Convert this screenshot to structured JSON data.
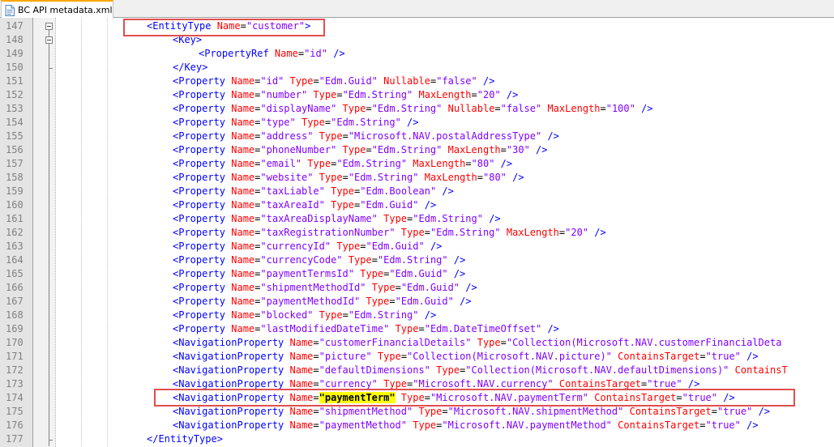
{
  "tab": {
    "label": "BC API metadata.xml",
    "icon": "xml-file-icon"
  },
  "lines": [
    {
      "num": "147",
      "indent": 12,
      "segs": [
        [
          "tag",
          "<EntityType "
        ],
        [
          "attr",
          "Name"
        ],
        [
          "eq",
          "="
        ],
        [
          "val",
          "\"customer\""
        ],
        [
          "tag",
          ">"
        ]
      ]
    },
    {
      "num": "148",
      "indent": 16,
      "segs": [
        [
          "tag",
          "<Key>"
        ]
      ]
    },
    {
      "num": "149",
      "indent": 20,
      "segs": [
        [
          "tag",
          "<PropertyRef "
        ],
        [
          "attr",
          "Name"
        ],
        [
          "eq",
          "="
        ],
        [
          "val",
          "\"id\""
        ],
        [
          "tag",
          " />"
        ]
      ]
    },
    {
      "num": "150",
      "indent": 16,
      "segs": [
        [
          "tag",
          "</Key>"
        ]
      ]
    },
    {
      "num": "151",
      "indent": 16,
      "segs": [
        [
          "tag",
          "<Property "
        ],
        [
          "attr",
          "Name"
        ],
        [
          "eq",
          "="
        ],
        [
          "val",
          "\"id\""
        ],
        [
          "tag",
          " "
        ],
        [
          "attr",
          "Type"
        ],
        [
          "eq",
          "="
        ],
        [
          "val",
          "\"Edm.Guid\""
        ],
        [
          "tag",
          " "
        ],
        [
          "attr",
          "Nullable"
        ],
        [
          "eq",
          "="
        ],
        [
          "val",
          "\"false\""
        ],
        [
          "tag",
          " />"
        ]
      ]
    },
    {
      "num": "152",
      "indent": 16,
      "segs": [
        [
          "tag",
          "<Property "
        ],
        [
          "attr",
          "Name"
        ],
        [
          "eq",
          "="
        ],
        [
          "val",
          "\"number\""
        ],
        [
          "tag",
          " "
        ],
        [
          "attr",
          "Type"
        ],
        [
          "eq",
          "="
        ],
        [
          "val",
          "\"Edm.String\""
        ],
        [
          "tag",
          " "
        ],
        [
          "attr",
          "MaxLength"
        ],
        [
          "eq",
          "="
        ],
        [
          "val",
          "\"20\""
        ],
        [
          "tag",
          " />"
        ]
      ]
    },
    {
      "num": "153",
      "indent": 16,
      "segs": [
        [
          "tag",
          "<Property "
        ],
        [
          "attr",
          "Name"
        ],
        [
          "eq",
          "="
        ],
        [
          "val",
          "\"displayName\""
        ],
        [
          "tag",
          " "
        ],
        [
          "attr",
          "Type"
        ],
        [
          "eq",
          "="
        ],
        [
          "val",
          "\"Edm.String\""
        ],
        [
          "tag",
          " "
        ],
        [
          "attr",
          "Nullable"
        ],
        [
          "eq",
          "="
        ],
        [
          "val",
          "\"false\""
        ],
        [
          "tag",
          " "
        ],
        [
          "attr",
          "MaxLength"
        ],
        [
          "eq",
          "="
        ],
        [
          "val",
          "\"100\""
        ],
        [
          "tag",
          " />"
        ]
      ]
    },
    {
      "num": "154",
      "indent": 16,
      "segs": [
        [
          "tag",
          "<Property "
        ],
        [
          "attr",
          "Name"
        ],
        [
          "eq",
          "="
        ],
        [
          "val",
          "\"type\""
        ],
        [
          "tag",
          " "
        ],
        [
          "attr",
          "Type"
        ],
        [
          "eq",
          "="
        ],
        [
          "val",
          "\"Edm.String\""
        ],
        [
          "tag",
          " />"
        ]
      ]
    },
    {
      "num": "155",
      "indent": 16,
      "segs": [
        [
          "tag",
          "<Property "
        ],
        [
          "attr",
          "Name"
        ],
        [
          "eq",
          "="
        ],
        [
          "val",
          "\"address\""
        ],
        [
          "tag",
          " "
        ],
        [
          "attr",
          "Type"
        ],
        [
          "eq",
          "="
        ],
        [
          "val",
          "\"Microsoft.NAV.postalAddressType\""
        ],
        [
          "tag",
          " />"
        ]
      ]
    },
    {
      "num": "156",
      "indent": 16,
      "segs": [
        [
          "tag",
          "<Property "
        ],
        [
          "attr",
          "Name"
        ],
        [
          "eq",
          "="
        ],
        [
          "val",
          "\"phoneNumber\""
        ],
        [
          "tag",
          " "
        ],
        [
          "attr",
          "Type"
        ],
        [
          "eq",
          "="
        ],
        [
          "val",
          "\"Edm.String\""
        ],
        [
          "tag",
          " "
        ],
        [
          "attr",
          "MaxLength"
        ],
        [
          "eq",
          "="
        ],
        [
          "val",
          "\"30\""
        ],
        [
          "tag",
          " />"
        ]
      ]
    },
    {
      "num": "157",
      "indent": 16,
      "segs": [
        [
          "tag",
          "<Property "
        ],
        [
          "attr",
          "Name"
        ],
        [
          "eq",
          "="
        ],
        [
          "val",
          "\"email\""
        ],
        [
          "tag",
          " "
        ],
        [
          "attr",
          "Type"
        ],
        [
          "eq",
          "="
        ],
        [
          "val",
          "\"Edm.String\""
        ],
        [
          "tag",
          " "
        ],
        [
          "attr",
          "MaxLength"
        ],
        [
          "eq",
          "="
        ],
        [
          "val",
          "\"80\""
        ],
        [
          "tag",
          " />"
        ]
      ]
    },
    {
      "num": "158",
      "indent": 16,
      "segs": [
        [
          "tag",
          "<Property "
        ],
        [
          "attr",
          "Name"
        ],
        [
          "eq",
          "="
        ],
        [
          "val",
          "\"website\""
        ],
        [
          "tag",
          " "
        ],
        [
          "attr",
          "Type"
        ],
        [
          "eq",
          "="
        ],
        [
          "val",
          "\"Edm.String\""
        ],
        [
          "tag",
          " "
        ],
        [
          "attr",
          "MaxLength"
        ],
        [
          "eq",
          "="
        ],
        [
          "val",
          "\"80\""
        ],
        [
          "tag",
          " />"
        ]
      ]
    },
    {
      "num": "159",
      "indent": 16,
      "segs": [
        [
          "tag",
          "<Property "
        ],
        [
          "attr",
          "Name"
        ],
        [
          "eq",
          "="
        ],
        [
          "val",
          "\"taxLiable\""
        ],
        [
          "tag",
          " "
        ],
        [
          "attr",
          "Type"
        ],
        [
          "eq",
          "="
        ],
        [
          "val",
          "\"Edm.Boolean\""
        ],
        [
          "tag",
          " />"
        ]
      ]
    },
    {
      "num": "160",
      "indent": 16,
      "segs": [
        [
          "tag",
          "<Property "
        ],
        [
          "attr",
          "Name"
        ],
        [
          "eq",
          "="
        ],
        [
          "val",
          "\"taxAreaId\""
        ],
        [
          "tag",
          " "
        ],
        [
          "attr",
          "Type"
        ],
        [
          "eq",
          "="
        ],
        [
          "val",
          "\"Edm.Guid\""
        ],
        [
          "tag",
          " />"
        ]
      ]
    },
    {
      "num": "161",
      "indent": 16,
      "segs": [
        [
          "tag",
          "<Property "
        ],
        [
          "attr",
          "Name"
        ],
        [
          "eq",
          "="
        ],
        [
          "val",
          "\"taxAreaDisplayName\""
        ],
        [
          "tag",
          " "
        ],
        [
          "attr",
          "Type"
        ],
        [
          "eq",
          "="
        ],
        [
          "val",
          "\"Edm.String\""
        ],
        [
          "tag",
          " />"
        ]
      ]
    },
    {
      "num": "162",
      "indent": 16,
      "segs": [
        [
          "tag",
          "<Property "
        ],
        [
          "attr",
          "Name"
        ],
        [
          "eq",
          "="
        ],
        [
          "val",
          "\"taxRegistrationNumber\""
        ],
        [
          "tag",
          " "
        ],
        [
          "attr",
          "Type"
        ],
        [
          "eq",
          "="
        ],
        [
          "val",
          "\"Edm.String\""
        ],
        [
          "tag",
          " "
        ],
        [
          "attr",
          "MaxLength"
        ],
        [
          "eq",
          "="
        ],
        [
          "val",
          "\"20\""
        ],
        [
          "tag",
          " />"
        ]
      ]
    },
    {
      "num": "163",
      "indent": 16,
      "segs": [
        [
          "tag",
          "<Property "
        ],
        [
          "attr",
          "Name"
        ],
        [
          "eq",
          "="
        ],
        [
          "val",
          "\"currencyId\""
        ],
        [
          "tag",
          " "
        ],
        [
          "attr",
          "Type"
        ],
        [
          "eq",
          "="
        ],
        [
          "val",
          "\"Edm.Guid\""
        ],
        [
          "tag",
          " />"
        ]
      ]
    },
    {
      "num": "164",
      "indent": 16,
      "segs": [
        [
          "tag",
          "<Property "
        ],
        [
          "attr",
          "Name"
        ],
        [
          "eq",
          "="
        ],
        [
          "val",
          "\"currencyCode\""
        ],
        [
          "tag",
          " "
        ],
        [
          "attr",
          "Type"
        ],
        [
          "eq",
          "="
        ],
        [
          "val",
          "\"Edm.String\""
        ],
        [
          "tag",
          " />"
        ]
      ]
    },
    {
      "num": "165",
      "indent": 16,
      "segs": [
        [
          "tag",
          "<Property "
        ],
        [
          "attr",
          "Name"
        ],
        [
          "eq",
          "="
        ],
        [
          "val",
          "\"paymentTermsId\""
        ],
        [
          "tag",
          " "
        ],
        [
          "attr",
          "Type"
        ],
        [
          "eq",
          "="
        ],
        [
          "val",
          "\"Edm.Guid\""
        ],
        [
          "tag",
          " />"
        ]
      ]
    },
    {
      "num": "166",
      "indent": 16,
      "segs": [
        [
          "tag",
          "<Property "
        ],
        [
          "attr",
          "Name"
        ],
        [
          "eq",
          "="
        ],
        [
          "val",
          "\"shipmentMethodId\""
        ],
        [
          "tag",
          " "
        ],
        [
          "attr",
          "Type"
        ],
        [
          "eq",
          "="
        ],
        [
          "val",
          "\"Edm.Guid\""
        ],
        [
          "tag",
          " />"
        ]
      ]
    },
    {
      "num": "167",
      "indent": 16,
      "segs": [
        [
          "tag",
          "<Property "
        ],
        [
          "attr",
          "Name"
        ],
        [
          "eq",
          "="
        ],
        [
          "val",
          "\"paymentMethodId\""
        ],
        [
          "tag",
          " "
        ],
        [
          "attr",
          "Type"
        ],
        [
          "eq",
          "="
        ],
        [
          "val",
          "\"Edm.Guid\""
        ],
        [
          "tag",
          " />"
        ]
      ]
    },
    {
      "num": "168",
      "indent": 16,
      "segs": [
        [
          "tag",
          "<Property "
        ],
        [
          "attr",
          "Name"
        ],
        [
          "eq",
          "="
        ],
        [
          "val",
          "\"blocked\""
        ],
        [
          "tag",
          " "
        ],
        [
          "attr",
          "Type"
        ],
        [
          "eq",
          "="
        ],
        [
          "val",
          "\"Edm.String\""
        ],
        [
          "tag",
          " />"
        ]
      ]
    },
    {
      "num": "169",
      "indent": 16,
      "segs": [
        [
          "tag",
          "<Property "
        ],
        [
          "attr",
          "Name"
        ],
        [
          "eq",
          "="
        ],
        [
          "val",
          "\"lastModifiedDateTime\""
        ],
        [
          "tag",
          " "
        ],
        [
          "attr",
          "Type"
        ],
        [
          "eq",
          "="
        ],
        [
          "val",
          "\"Edm.DateTimeOffset\""
        ],
        [
          "tag",
          " />"
        ]
      ]
    },
    {
      "num": "170",
      "indent": 16,
      "segs": [
        [
          "tag",
          "<NavigationProperty "
        ],
        [
          "attr",
          "Name"
        ],
        [
          "eq",
          "="
        ],
        [
          "val",
          "\"customerFinancialDetails\""
        ],
        [
          "tag",
          " "
        ],
        [
          "attr",
          "Type"
        ],
        [
          "eq",
          "="
        ],
        [
          "val",
          "\"Collection(Microsoft.NAV.customerFinancialDeta"
        ]
      ]
    },
    {
      "num": "171",
      "indent": 16,
      "segs": [
        [
          "tag",
          "<NavigationProperty "
        ],
        [
          "attr",
          "Name"
        ],
        [
          "eq",
          "="
        ],
        [
          "val",
          "\"picture\""
        ],
        [
          "tag",
          " "
        ],
        [
          "attr",
          "Type"
        ],
        [
          "eq",
          "="
        ],
        [
          "val",
          "\"Collection(Microsoft.NAV.picture)\""
        ],
        [
          "tag",
          " "
        ],
        [
          "attr",
          "ContainsTarget"
        ],
        [
          "eq",
          "="
        ],
        [
          "val",
          "\"true\""
        ],
        [
          "tag",
          " />"
        ]
      ]
    },
    {
      "num": "172",
      "indent": 16,
      "segs": [
        [
          "tag",
          "<NavigationProperty "
        ],
        [
          "attr",
          "Name"
        ],
        [
          "eq",
          "="
        ],
        [
          "val",
          "\"defaultDimensions\""
        ],
        [
          "tag",
          " "
        ],
        [
          "attr",
          "Type"
        ],
        [
          "eq",
          "="
        ],
        [
          "val",
          "\"Collection(Microsoft.NAV.defaultDimensions)\""
        ],
        [
          "tag",
          " "
        ],
        [
          "attr",
          "ContainsT"
        ]
      ]
    },
    {
      "num": "173",
      "indent": 16,
      "segs": [
        [
          "tag",
          "<NavigationProperty "
        ],
        [
          "attr",
          "Name"
        ],
        [
          "eq",
          "="
        ],
        [
          "val",
          "\"currency\""
        ],
        [
          "tag",
          " "
        ],
        [
          "attr",
          "Type"
        ],
        [
          "eq",
          "="
        ],
        [
          "val",
          "\"Microsoft.NAV.currency\""
        ],
        [
          "tag",
          " "
        ],
        [
          "attr",
          "ContainsTarget"
        ],
        [
          "eq",
          "="
        ],
        [
          "val",
          "\"true\""
        ],
        [
          "tag",
          " />"
        ]
      ]
    },
    {
      "num": "174",
      "indent": 16,
      "segs": [
        [
          "tag",
          "<NavigationProperty "
        ],
        [
          "attr",
          "Name"
        ],
        [
          "eq",
          "="
        ],
        [
          "hl",
          "\"paymentTerm\""
        ],
        [
          "tag",
          " "
        ],
        [
          "attr",
          "Type"
        ],
        [
          "eq",
          "="
        ],
        [
          "val",
          "\"Microsoft.NAV.paymentTerm\""
        ],
        [
          "tag",
          " "
        ],
        [
          "attr",
          "ContainsTarget"
        ],
        [
          "eq",
          "="
        ],
        [
          "val",
          "\"true\""
        ],
        [
          "tag",
          " />"
        ]
      ]
    },
    {
      "num": "175",
      "indent": 16,
      "segs": [
        [
          "tag",
          "<NavigationProperty "
        ],
        [
          "attr",
          "Name"
        ],
        [
          "eq",
          "="
        ],
        [
          "val",
          "\"shipmentMethod\""
        ],
        [
          "tag",
          " "
        ],
        [
          "attr",
          "Type"
        ],
        [
          "eq",
          "="
        ],
        [
          "val",
          "\"Microsoft.NAV.shipmentMethod\""
        ],
        [
          "tag",
          " "
        ],
        [
          "attr",
          "ContainsTarget"
        ],
        [
          "eq",
          "="
        ],
        [
          "val",
          "\"true\""
        ],
        [
          "tag",
          " />"
        ]
      ]
    },
    {
      "num": "176",
      "indent": 16,
      "segs": [
        [
          "tag",
          "<NavigationProperty "
        ],
        [
          "attr",
          "Name"
        ],
        [
          "eq",
          "="
        ],
        [
          "val",
          "\"paymentMethod\""
        ],
        [
          "tag",
          " "
        ],
        [
          "attr",
          "Type"
        ],
        [
          "eq",
          "="
        ],
        [
          "val",
          "\"Microsoft.NAV.paymentMethod\""
        ],
        [
          "tag",
          " "
        ],
        [
          "attr",
          "ContainsTarget"
        ],
        [
          "eq",
          "="
        ],
        [
          "val",
          "\"true\""
        ],
        [
          "tag",
          " />"
        ]
      ]
    },
    {
      "num": "177",
      "indent": 12,
      "segs": [
        [
          "tag",
          "</EntityType>"
        ]
      ]
    }
  ],
  "highlight": {
    "line_index": 27,
    "text": "\"paymentTerm\""
  },
  "colors": {
    "tag": "#0000ff",
    "attribute": "#ff0000",
    "value": "#8000ff",
    "highlight_bg": "#ffff00",
    "callout_box": "#e0504f",
    "tab_accent": "#ffa500"
  }
}
